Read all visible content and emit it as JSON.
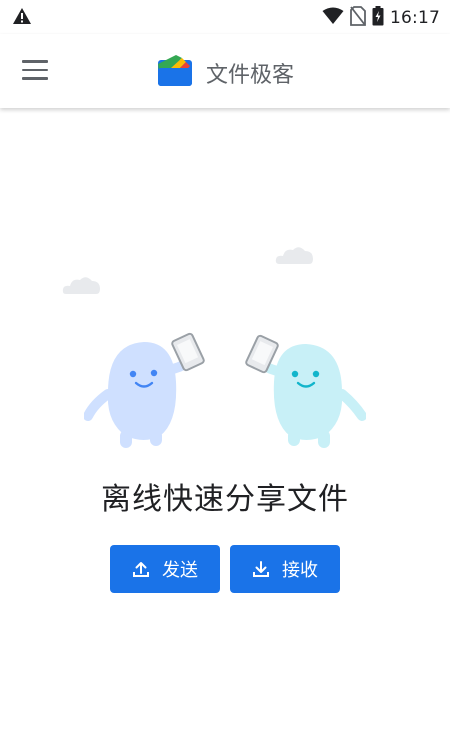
{
  "status_bar": {
    "time": "16:17",
    "icons": [
      "warning-icon",
      "wifi-icon",
      "no-sim-icon",
      "battery-charging-icon"
    ]
  },
  "app_bar": {
    "title": "文件极客",
    "menu_icon": "hamburger-menu-icon",
    "logo_icon": "files-logo-icon"
  },
  "main": {
    "headline": "离线快速分享文件",
    "send_label": "发送",
    "receive_label": "接收",
    "send_icon": "upload-icon",
    "receive_icon": "download-icon"
  },
  "colors": {
    "accent": "#1a73e8",
    "character_left": "#cfe0ff",
    "character_right": "#c8f0f7"
  }
}
